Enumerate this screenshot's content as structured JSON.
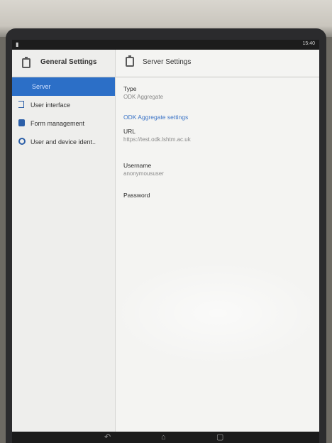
{
  "statusbar": {
    "time": "15:40"
  },
  "left_pane": {
    "title": "General Settings",
    "items": [
      {
        "label": "Server",
        "active": true
      },
      {
        "label": "User interface",
        "icon": "door-icon"
      },
      {
        "label": "Form management",
        "icon": "form-icon"
      },
      {
        "label": "User and device ident..",
        "icon": "user-icon"
      }
    ]
  },
  "right_pane": {
    "title": "Server Settings",
    "type": {
      "title": "Type",
      "summary": "ODK Aggregate"
    },
    "category": "ODK Aggregate settings",
    "url": {
      "title": "URL",
      "summary": "https://test.odk.lshtm.ac.uk"
    },
    "username": {
      "title": "Username",
      "summary": "anonymoususer"
    },
    "password": {
      "title": "Password"
    }
  },
  "colors": {
    "accent": "#2c6fc7",
    "category": "#3b74c7"
  }
}
